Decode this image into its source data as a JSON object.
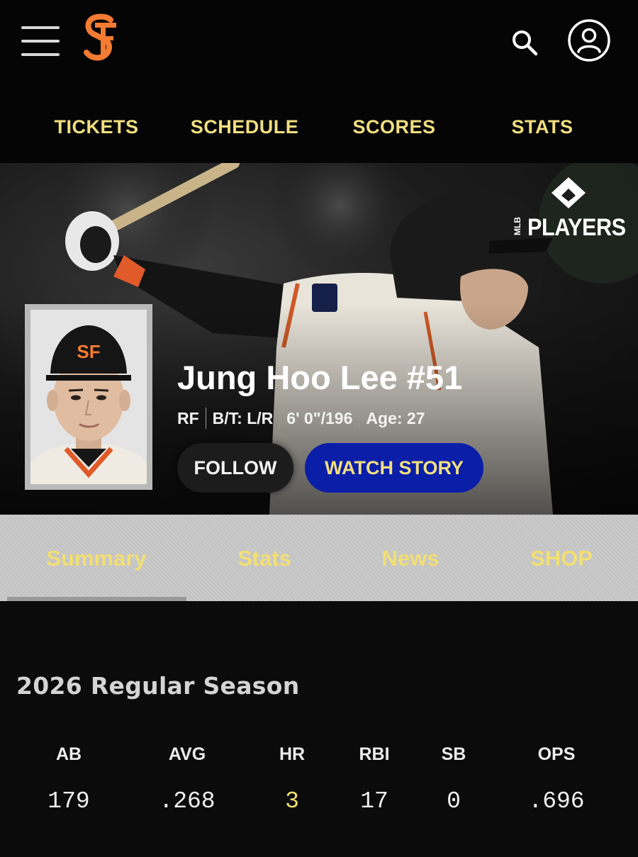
{
  "header": {
    "menu_icon": "hamburger-menu-icon",
    "logo": "sf-giants-logo",
    "search_icon": "search-icon",
    "account_icon": "user-account-icon"
  },
  "nav": {
    "items": [
      "TICKETS",
      "SCHEDULE",
      "SCORES",
      "STATS"
    ]
  },
  "player": {
    "name": "Jung Hoo Lee #51",
    "bio": [
      "RF",
      "B/T: L/R",
      "6' 0\"/196",
      "Age: 27"
    ],
    "follow_label": "FOLLOW",
    "watch_label": "WATCH STORY",
    "badge_text": "PLAYERS",
    "badge_mini": "MLB"
  },
  "tabs": {
    "items": [
      "Summary",
      "Stats",
      "News",
      "SHOP"
    ],
    "active": "Summary"
  },
  "season": {
    "title": "2026 Regular Season",
    "headers": [
      "AB",
      "AVG",
      "HR",
      "RBI",
      "SB",
      "OPS"
    ],
    "values": [
      "179",
      ".268",
      "3",
      "17",
      "0",
      ".696"
    ]
  },
  "colors": {
    "accent_yellow": "#f1de80",
    "button_blue": "#0a1ea8",
    "giants_orange": "#f47b32",
    "background": "#0b0b0b"
  }
}
